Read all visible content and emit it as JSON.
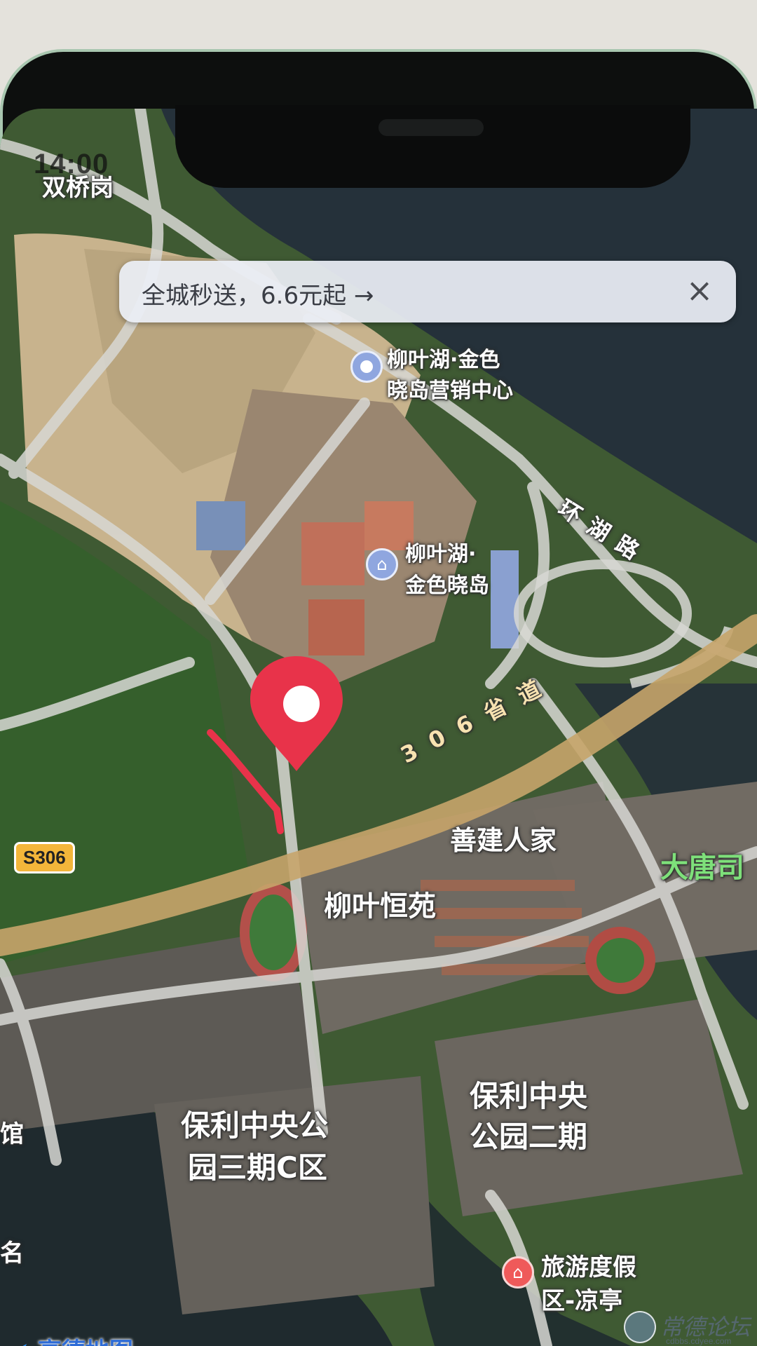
{
  "status_bar": {
    "time": "14:00"
  },
  "banner": {
    "text": "全城秒送，6.6元起 →",
    "close_icon": "close-icon"
  },
  "map": {
    "labels": {
      "shuangqiao": "双桥岗",
      "liuyehu_center_line1": "柳叶湖·金色",
      "liuyehu_center_line2": "晓岛营销中心",
      "huanhu_road": "环湖路",
      "liuyehu_jinse_line1": "柳叶湖·",
      "liuyehu_jinse_line2": "金色晓岛",
      "road_306": "306省道",
      "shanjian": "善建人家",
      "datang": "大唐司",
      "liuyehengyuan": "柳叶恒苑",
      "baoli_c_line1": "保利中央公",
      "baoli_c_line2": "园三期C区",
      "baoli_2_line1": "保利中央",
      "baoli_2_line2": "公园二期",
      "resort_line1": "旅游度假",
      "resort_line2": "区-凉亭",
      "edge_left_1": "馆",
      "edge_left_2": "名"
    },
    "road_badge": "S306",
    "colors": {
      "water": "#26333a",
      "vegetation": "#3d6b32",
      "soil": "#c9b48e",
      "road": "#d8d8d4",
      "provincial_road": "#c6a46a",
      "marker": "#e8334a"
    }
  },
  "logo": {
    "text": "高德地图"
  },
  "watermark": {
    "text": "常德论坛",
    "url": "cdbbs.cdyee.com"
  }
}
